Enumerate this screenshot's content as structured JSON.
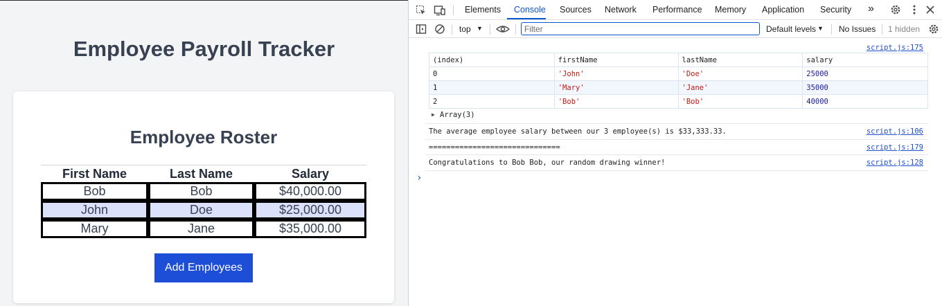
{
  "page": {
    "title": "Employee Payroll Tracker",
    "roster_title": "Employee Roster",
    "columns": [
      "First Name",
      "Last Name",
      "Salary"
    ],
    "rows": [
      {
        "first": "Bob",
        "last": "Bob",
        "salary": "$40,000.00"
      },
      {
        "first": "John",
        "last": "Doe",
        "salary": "$25,000.00"
      },
      {
        "first": "Mary",
        "last": "Jane",
        "salary": "$35,000.00"
      }
    ],
    "add_button": "Add Employees"
  },
  "devtools": {
    "tabs": [
      "Elements",
      "Console",
      "Sources",
      "Network",
      "Performance",
      "Memory",
      "Application",
      "Security"
    ],
    "active_tab": "Console",
    "more_tabs": "»",
    "toolbar": {
      "context": "top",
      "filter_placeholder": "Filter",
      "levels": "Default levels",
      "issues": "No Issues",
      "hidden": "1 hidden"
    },
    "console": {
      "table_link": "script.js:175",
      "table_headers": [
        "(index)",
        "firstName",
        "lastName",
        "salary"
      ],
      "table_rows": [
        {
          "index": "0",
          "first": "'John'",
          "last": "'Doe'",
          "salary": "25000"
        },
        {
          "index": "1",
          "first": "'Mary'",
          "last": "'Jane'",
          "salary": "35000"
        },
        {
          "index": "2",
          "first": "'Bob'",
          "last": "'Bob'",
          "salary": "40000"
        }
      ],
      "array_label": "Array(3)",
      "messages": [
        {
          "text": "The average employee salary between our 3 employee(s) is $33,333.33.",
          "link": "script.js:106"
        },
        {
          "text": "==============================",
          "link": "script.js:179"
        },
        {
          "text": "Congratulations to Bob Bob, our random drawing winner!",
          "link": "script.js:128"
        }
      ],
      "prompt": "›"
    }
  }
}
